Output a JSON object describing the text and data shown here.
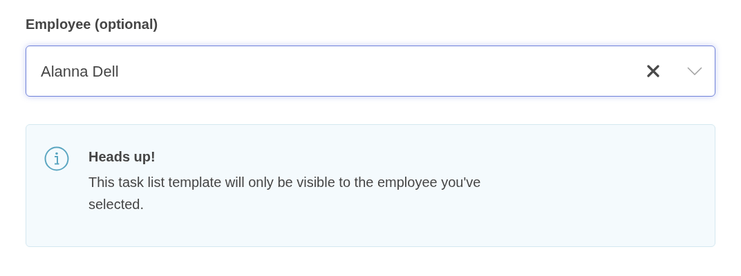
{
  "employee_field": {
    "label": "Employee (optional)",
    "value": "Alanna Dell",
    "focused": true
  },
  "alert": {
    "title": "Heads up!",
    "message": "This task list template will only be visible to the employee you've selected."
  }
}
